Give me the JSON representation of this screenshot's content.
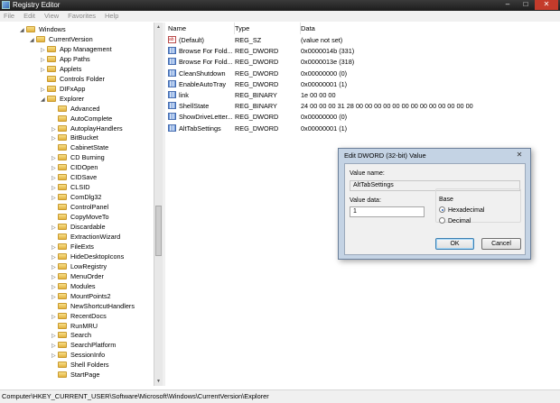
{
  "window": {
    "title": "Registry Editor",
    "controls": [
      "–",
      "□",
      "✕"
    ]
  },
  "menu": [
    "File",
    "Edit",
    "View",
    "Favorites",
    "Help"
  ],
  "tree": [
    {
      "label": "Windows",
      "depth": 0,
      "arrow": "◢"
    },
    {
      "label": "CurrentVersion",
      "depth": 1,
      "arrow": "◢"
    },
    {
      "label": "App Management",
      "depth": 2,
      "arrow": "▷"
    },
    {
      "label": "App Paths",
      "depth": 2,
      "arrow": "▷"
    },
    {
      "label": "Applets",
      "depth": 2,
      "arrow": "▷"
    },
    {
      "label": "Controls Folder",
      "depth": 2,
      "arrow": ""
    },
    {
      "label": "DIFxApp",
      "depth": 2,
      "arrow": "▷"
    },
    {
      "label": "Explorer",
      "depth": 2,
      "arrow": "◢"
    },
    {
      "label": "Advanced",
      "depth": 3,
      "arrow": ""
    },
    {
      "label": "AutoComplete",
      "depth": 3,
      "arrow": ""
    },
    {
      "label": "AutoplayHandlers",
      "depth": 3,
      "arrow": "▷"
    },
    {
      "label": "BitBucket",
      "depth": 3,
      "arrow": "▷"
    },
    {
      "label": "CabinetState",
      "depth": 3,
      "arrow": ""
    },
    {
      "label": "CD Burning",
      "depth": 3,
      "arrow": "▷"
    },
    {
      "label": "CIDOpen",
      "depth": 3,
      "arrow": "▷"
    },
    {
      "label": "CIDSave",
      "depth": 3,
      "arrow": "▷"
    },
    {
      "label": "CLSID",
      "depth": 3,
      "arrow": "▷"
    },
    {
      "label": "ComDlg32",
      "depth": 3,
      "arrow": "▷"
    },
    {
      "label": "ControlPanel",
      "depth": 3,
      "arrow": ""
    },
    {
      "label": "CopyMoveTo",
      "depth": 3,
      "arrow": ""
    },
    {
      "label": "Discardable",
      "depth": 3,
      "arrow": "▷"
    },
    {
      "label": "ExtractionWizard",
      "depth": 3,
      "arrow": ""
    },
    {
      "label": "FileExts",
      "depth": 3,
      "arrow": "▷"
    },
    {
      "label": "HideDesktopIcons",
      "depth": 3,
      "arrow": "▷"
    },
    {
      "label": "LowRegistry",
      "depth": 3,
      "arrow": "▷"
    },
    {
      "label": "MenuOrder",
      "depth": 3,
      "arrow": "▷"
    },
    {
      "label": "Modules",
      "depth": 3,
      "arrow": "▷"
    },
    {
      "label": "MountPoints2",
      "depth": 3,
      "arrow": "▷"
    },
    {
      "label": "NewShortcutHandlers",
      "depth": 3,
      "arrow": ""
    },
    {
      "label": "RecentDocs",
      "depth": 3,
      "arrow": "▷"
    },
    {
      "label": "RunMRU",
      "depth": 3,
      "arrow": ""
    },
    {
      "label": "Search",
      "depth": 3,
      "arrow": "▷"
    },
    {
      "label": "SearchPlatform",
      "depth": 3,
      "arrow": "▷"
    },
    {
      "label": "SessionInfo",
      "depth": 3,
      "arrow": "▷"
    },
    {
      "label": "Shell Folders",
      "depth": 3,
      "arrow": ""
    },
    {
      "label": "StartPage",
      "depth": 3,
      "arrow": ""
    }
  ],
  "columns": [
    "Name",
    "Type",
    "Data"
  ],
  "values": [
    {
      "name": "(Default)",
      "type": "REG_SZ",
      "data": "(value not set)",
      "icon": "string-value-icon"
    },
    {
      "name": "Browse For Fold...",
      "type": "REG_DWORD",
      "data": "0x0000014b (331)",
      "icon": "binary-value-icon"
    },
    {
      "name": "Browse For Fold...",
      "type": "REG_DWORD",
      "data": "0x0000013e (318)",
      "icon": "binary-value-icon"
    },
    {
      "name": "CleanShutdown",
      "type": "REG_DWORD",
      "data": "0x00000000 (0)",
      "icon": "binary-value-icon"
    },
    {
      "name": "EnableAutoTray",
      "type": "REG_DWORD",
      "data": "0x00000001 (1)",
      "icon": "binary-value-icon"
    },
    {
      "name": "link",
      "type": "REG_BINARY",
      "data": "1e 00 00 00",
      "icon": "binary-value-icon"
    },
    {
      "name": "ShellState",
      "type": "REG_BINARY",
      "data": "24 00 00 00 31 28 00 00 00 00 00 00 00 00 00 00 00 00 00",
      "icon": "binary-value-icon"
    },
    {
      "name": "ShowDriveLetter...",
      "type": "REG_DWORD",
      "data": "0x00000000 (0)",
      "icon": "binary-value-icon"
    },
    {
      "name": "AltTabSettings",
      "type": "REG_DWORD",
      "data": "0x00000001 (1)",
      "icon": "binary-value-icon"
    }
  ],
  "dialog": {
    "title": "Edit DWORD (32-bit) Value",
    "value_name_label": "Value name:",
    "value_name": "AltTabSettings",
    "value_data_label": "Value data:",
    "value_data": "1",
    "base_label": "Base",
    "hex_label": "Hexadecimal",
    "dec_label": "Decimal",
    "selected_base": "Hexadecimal",
    "ok_label": "OK",
    "cancel_label": "Cancel",
    "close": "✕"
  },
  "status": "Computer\\HKEY_CURRENT_USER\\Software\\Microsoft\\Windows\\CurrentVersion\\Explorer"
}
